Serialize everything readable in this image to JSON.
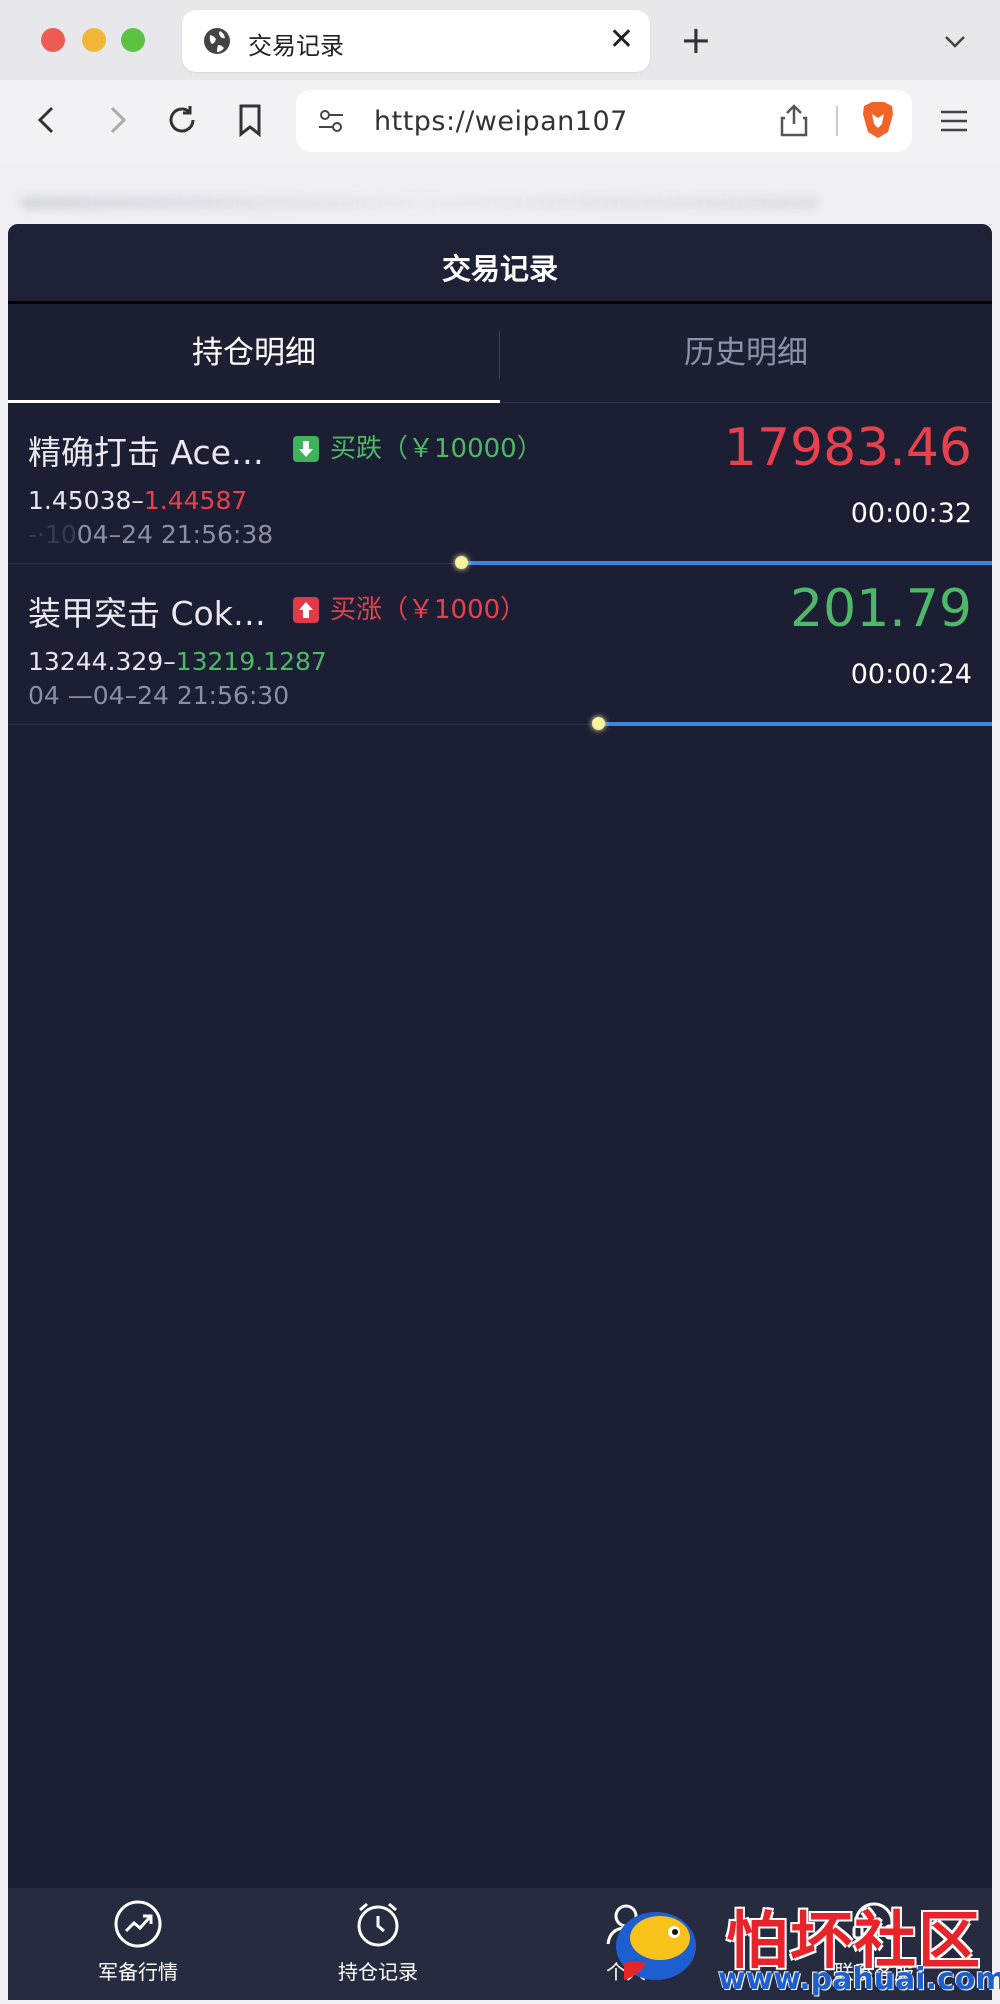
{
  "browser": {
    "tab_title": "交易记录",
    "url": "https://weipan107"
  },
  "app": {
    "title": "交易记录",
    "tabs": [
      {
        "label": "持仓明细",
        "active": true
      },
      {
        "label": "历史明细",
        "active": false
      }
    ],
    "positions": [
      {
        "name": "精确打击 Ace…",
        "direction_label": "买跌（￥10000）",
        "direction": "down",
        "open_price": "1.45038",
        "separator": "–",
        "current_price": "1.44587",
        "timestamp": "04–24 21:56:38",
        "timestamp_prefix": "-·10",
        "profit": "17983.46",
        "countdown": "00:00:32",
        "progress": 0.54
      },
      {
        "name": "装甲突击 Cok…",
        "direction_label": "买涨（￥1000）",
        "direction": "up",
        "open_price": "13244.329",
        "separator": "–",
        "current_price": "13219.1287",
        "timestamp": "04 —04–24 21:56:30",
        "timestamp_prefix": "",
        "profit": "201.79",
        "countdown": "00:00:24",
        "progress": 0.4
      }
    ]
  },
  "bottom_nav": [
    {
      "label": "军备行情",
      "icon": "trend-up-icon"
    },
    {
      "label": "持仓记录",
      "icon": "alarm-clock-icon"
    },
    {
      "label": "个人",
      "icon": "user-icon"
    },
    {
      "label": "联系客服",
      "icon": "headset-icon"
    }
  ],
  "watermark": {
    "brand": "怕坏社区",
    "url": "www.pahuai.com"
  },
  "colors": {
    "app_bg": "#1c1f33",
    "up_red": "#e8414d",
    "down_green": "#4fb868",
    "progress_blue": "#3b86e0"
  }
}
